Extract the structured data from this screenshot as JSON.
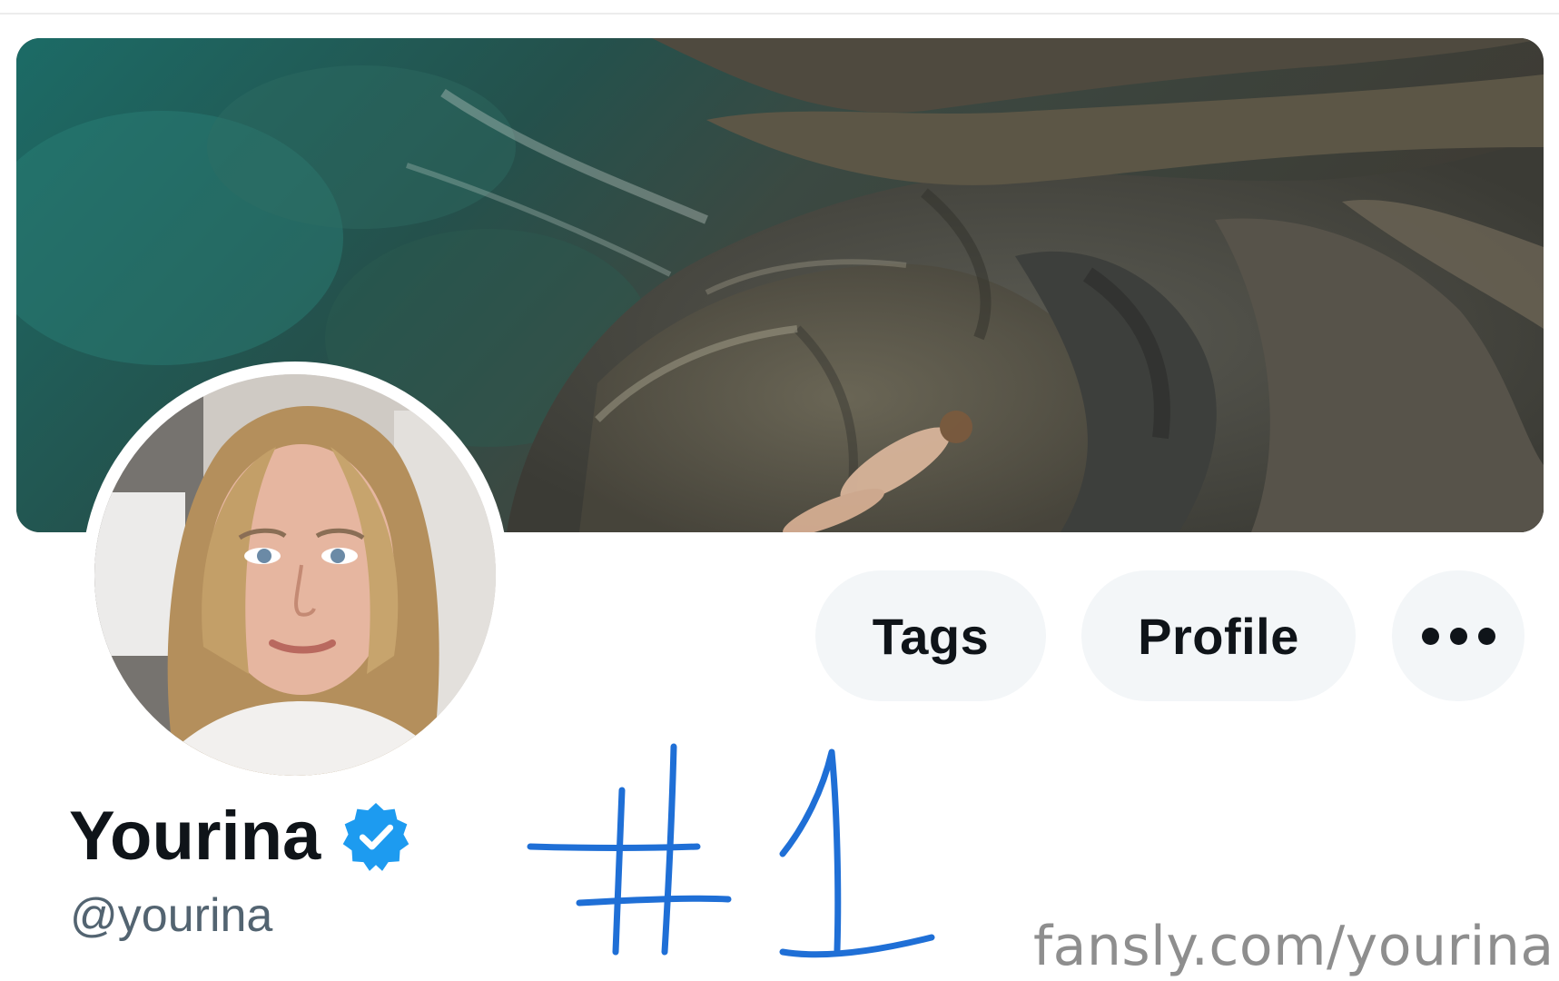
{
  "profile": {
    "display_name": "Yourina",
    "username": "@yourina",
    "verified": true,
    "banner_image": "aerial view of coastline rocks and turquoise sea with person lying on rock",
    "avatar_image": "portrait of woman with long blonde hair"
  },
  "actions": {
    "tags_label": "Tags",
    "profile_label": "Profile",
    "more_icon": "more-horizontal-icon"
  },
  "annotation": {
    "text": "#1",
    "color": "#1f6fd6"
  },
  "watermark": {
    "text": "fansly.com/yourina"
  },
  "colors": {
    "verified_badge": "#1d9bf0",
    "text_primary": "#0f1419",
    "text_secondary": "#536471",
    "pill_background": "#f3f6f8"
  }
}
